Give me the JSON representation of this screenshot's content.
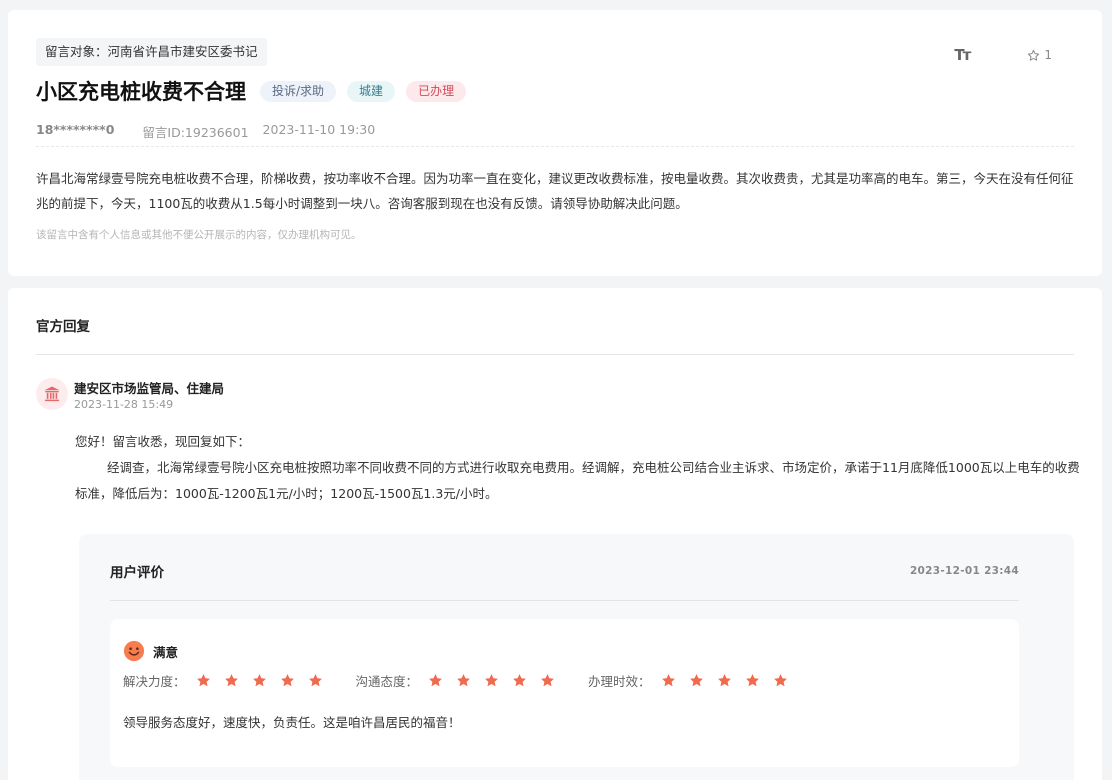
{
  "message": {
    "target_label": "留言对象：",
    "target_value": "河南省许昌市建安区委书记",
    "title": "小区充电桩收费不合理",
    "tags": [
      "投诉/求助",
      "城建",
      "已办理"
    ],
    "user": "18********0",
    "message_id": "留言ID:19236601",
    "time": "2023-11-10 19:30",
    "content": "许昌北海常绿壹号院充电桩收费不合理，阶梯收费，按功率收不合理。因为功率一直在变化，建议更改收费标准，按电量收费。其次收费贵，尤其是功率高的电车。第三，今天在没有任何征兆的前提下，今天，1100瓦的收费从1.5每小时调整到一块八。咨询客服到现在也没有反馈。请领导协助解决此问题。",
    "privacy_note": "该留言中含有个人信息或其他不便公开展示的内容，仅办理机构可见。",
    "font_size_icon": "Tт",
    "favorite_count": "1",
    "tag_colors": {
      "tag1": "#5a6b86",
      "tag2": "#3b7c8c",
      "tag3": "#d34a5a"
    }
  },
  "reply": {
    "section_title": "官方回复",
    "department": "建安区市场监管局、住建局",
    "time": "2023-11-28 15:49",
    "greeting": "您好！留言收悉，现回复如下：",
    "body": "经调查，北海常绿壹号院小区充电桩按照功率不同收费不同的方式进行收取充电费用。经调解，充电桩公司结合业主诉求、市场定价，承诺于11月底降低1000瓦以上电车的收费标准，降低后为：1000瓦-1200瓦1元/小时；1200瓦-1500瓦1.3元/小时。"
  },
  "evaluation": {
    "section_title": "用户评价",
    "time": "2023-12-01 23:44",
    "satisfaction": "满意",
    "ratings": [
      {
        "label": "解决力度：",
        "stars": 5
      },
      {
        "label": "沟通态度：",
        "stars": 5
      },
      {
        "label": "办理时效：",
        "stars": 5
      }
    ],
    "comment": "领导服务态度好，速度快，负责任。这是咱许昌居民的福音！",
    "star_color": "#f06a4e"
  }
}
